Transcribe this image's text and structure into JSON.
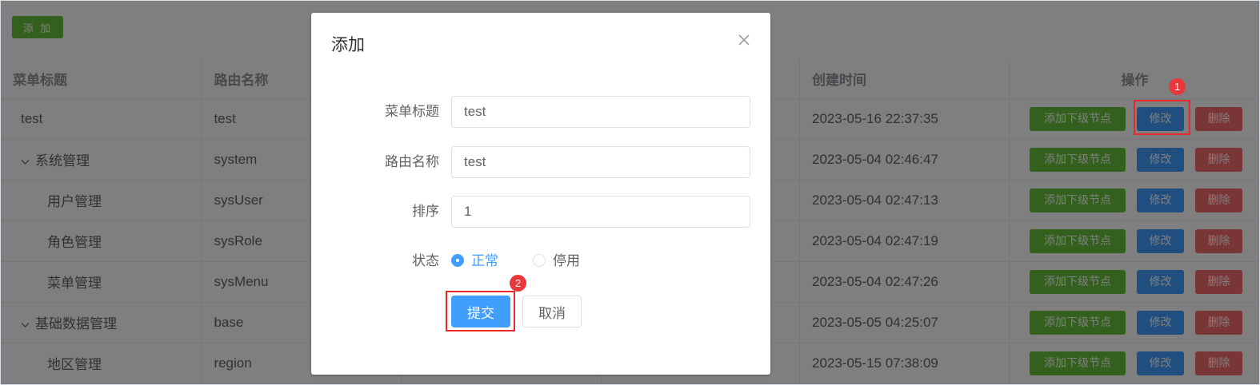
{
  "toolbar": {
    "add_label": "添 加"
  },
  "table": {
    "headers": {
      "title": "菜单标题",
      "route": "路由名称",
      "mid1": "",
      "mid2": "",
      "time": "创建时间",
      "ops": "操作"
    },
    "rows": [
      {
        "title": "test",
        "route": "test",
        "time": "2023-05-16 22:37:35",
        "level": 1,
        "expand": false
      },
      {
        "title": "系统管理",
        "route": "system",
        "time": "2023-05-04 02:46:47",
        "level": 1,
        "expand": true
      },
      {
        "title": "用户管理",
        "route": "sysUser",
        "time": "2023-05-04 02:47:13",
        "level": 2,
        "expand": false
      },
      {
        "title": "角色管理",
        "route": "sysRole",
        "time": "2023-05-04 02:47:19",
        "level": 2,
        "expand": false
      },
      {
        "title": "菜单管理",
        "route": "sysMenu",
        "time": "2023-05-04 02:47:26",
        "level": 2,
        "expand": false
      },
      {
        "title": "基础数据管理",
        "route": "base",
        "time": "2023-05-05 04:25:07",
        "level": 1,
        "expand": true
      },
      {
        "title": "地区管理",
        "route": "region",
        "time": "2023-05-15 07:38:09",
        "level": 2,
        "expand": false
      }
    ],
    "row_ops": {
      "add_child": "添加下级节点",
      "edit": "修改",
      "delete": "删除"
    },
    "caret_icon": "chevron-down-icon"
  },
  "dialog": {
    "title": "添加",
    "close_icon": "close-icon",
    "fields": {
      "menu_title": {
        "label": "菜单标题",
        "value": "test"
      },
      "route_name": {
        "label": "路由名称",
        "value": "test"
      },
      "sort": {
        "label": "排序",
        "value": "1"
      },
      "status": {
        "label": "状态",
        "options": [
          "正常",
          "停用"
        ],
        "selected": "正常"
      }
    },
    "submit_label": "提交",
    "cancel_label": "取消"
  },
  "annotations": {
    "marker_1": "1",
    "marker_2": "2"
  },
  "colors": {
    "primary": "#409eff",
    "success": "#67c23a",
    "danger": "#f56c6c",
    "annotation_red": "#e8282b"
  }
}
